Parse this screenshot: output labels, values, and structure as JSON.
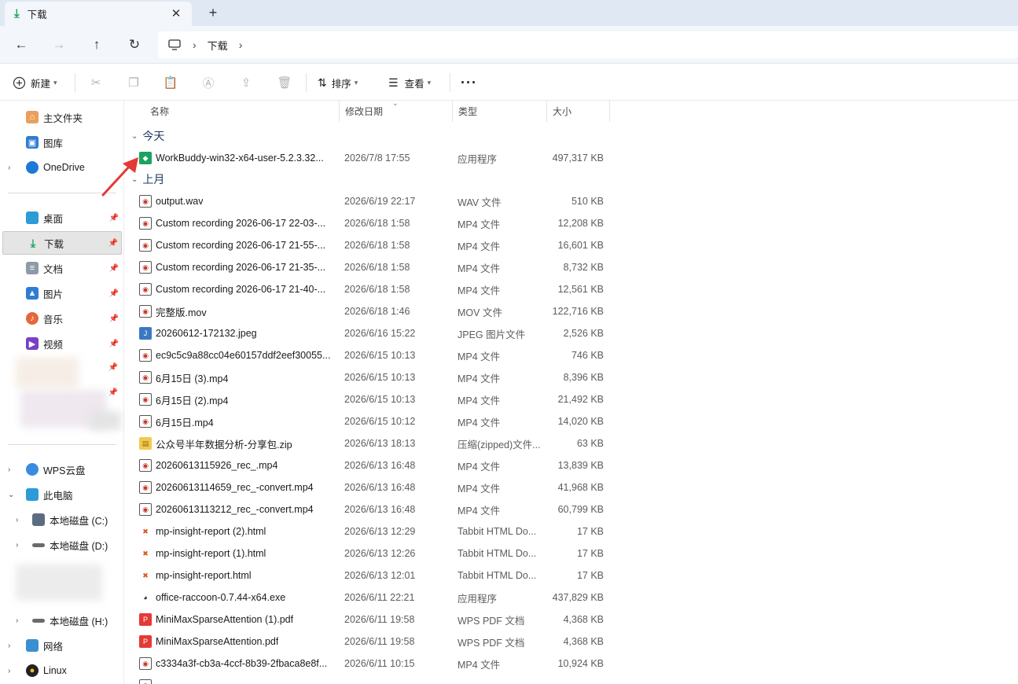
{
  "window": {
    "tab_title": "下载",
    "colors": {
      "titlebar": "#dfe8f3",
      "accent_green": "#1aa260",
      "selection": "#e5e5e5"
    }
  },
  "address": {
    "breadcrumbs": [
      "下载"
    ]
  },
  "toolbar": {
    "new_label": "新建",
    "sort_label": "排序",
    "view_label": "查看"
  },
  "sidebar": {
    "top": [
      {
        "label": "主文件夹",
        "icon": "home-icon"
      },
      {
        "label": "图库",
        "icon": "gallery-icon"
      },
      {
        "label": "OneDrive",
        "icon": "onedrive-icon"
      }
    ],
    "quick": [
      {
        "label": "桌面",
        "icon": "desktop-icon"
      },
      {
        "label": "下载",
        "icon": "download-icon"
      },
      {
        "label": "文档",
        "icon": "document-icon"
      },
      {
        "label": "图片",
        "icon": "picture-icon"
      },
      {
        "label": "音乐",
        "icon": "music-icon"
      },
      {
        "label": "视频",
        "icon": "video-icon"
      }
    ],
    "drives": [
      {
        "label": "WPS云盘",
        "icon": "wps-cloud-icon"
      },
      {
        "label": "此电脑",
        "icon": "this-pc-icon"
      },
      {
        "label": "本地磁盘 (C:)",
        "icon": "drive-c-icon"
      },
      {
        "label": "本地磁盘 (D:)",
        "icon": "drive-icon"
      },
      {
        "label": "本地磁盘 (H:)",
        "icon": "drive-icon"
      },
      {
        "label": "网络",
        "icon": "network-icon"
      },
      {
        "label": "Linux",
        "icon": "linux-icon"
      }
    ]
  },
  "columns": {
    "name": "名称",
    "date": "修改日期",
    "type": "类型",
    "size": "大小"
  },
  "groups": [
    {
      "label": "今天",
      "files": [
        {
          "name": "WorkBuddy-win32-x64-user-5.2.3.32...",
          "date": "2026/7/8 17:55",
          "type": "应用程序",
          "size": "497,317 KB",
          "icon": "app-installer-icon"
        }
      ]
    },
    {
      "label": "上月",
      "files": [
        {
          "name": "output.wav",
          "date": "2026/6/19 22:17",
          "type": "WAV 文件",
          "size": "510 KB",
          "icon": "media-file-icon"
        },
        {
          "name": "Custom recording 2026-06-17 22-03-...",
          "date": "2026/6/18 1:58",
          "type": "MP4 文件",
          "size": "12,208 KB",
          "icon": "media-file-icon"
        },
        {
          "name": "Custom recording 2026-06-17 21-55-...",
          "date": "2026/6/18 1:58",
          "type": "MP4 文件",
          "size": "16,601 KB",
          "icon": "media-file-icon"
        },
        {
          "name": "Custom recording 2026-06-17 21-35-...",
          "date": "2026/6/18 1:58",
          "type": "MP4 文件",
          "size": "8,732 KB",
          "icon": "media-file-icon"
        },
        {
          "name": "Custom recording 2026-06-17 21-40-...",
          "date": "2026/6/18 1:58",
          "type": "MP4 文件",
          "size": "12,561 KB",
          "icon": "media-file-icon"
        },
        {
          "name": "完整版.mov",
          "date": "2026/6/18 1:46",
          "type": "MOV 文件",
          "size": "122,716 KB",
          "icon": "media-file-icon"
        },
        {
          "name": "20260612-172132.jpeg",
          "date": "2026/6/16 15:22",
          "type": "JPEG 图片文件",
          "size": "2,526 KB",
          "icon": "jpeg-icon"
        },
        {
          "name": "ec9c5c9a88cc04e60157ddf2eef30055...",
          "date": "2026/6/15 10:13",
          "type": "MP4 文件",
          "size": "746 KB",
          "icon": "media-file-icon"
        },
        {
          "name": "6月15日 (3).mp4",
          "date": "2026/6/15 10:13",
          "type": "MP4 文件",
          "size": "8,396 KB",
          "icon": "media-file-icon"
        },
        {
          "name": "6月15日 (2).mp4",
          "date": "2026/6/15 10:13",
          "type": "MP4 文件",
          "size": "21,492 KB",
          "icon": "media-file-icon"
        },
        {
          "name": "6月15日.mp4",
          "date": "2026/6/15 10:12",
          "type": "MP4 文件",
          "size": "14,020 KB",
          "icon": "media-file-icon"
        },
        {
          "name": "公众号半年数据分析-分享包.zip",
          "date": "2026/6/13 18:13",
          "type": "压缩(zipped)文件...",
          "size": "63 KB",
          "icon": "zip-folder-icon"
        },
        {
          "name": "20260613115926_rec_.mp4",
          "date": "2026/6/13 16:48",
          "type": "MP4 文件",
          "size": "13,839 KB",
          "icon": "media-file-icon"
        },
        {
          "name": "20260613114659_rec_-convert.mp4",
          "date": "2026/6/13 16:48",
          "type": "MP4 文件",
          "size": "41,968 KB",
          "icon": "media-file-icon"
        },
        {
          "name": "20260613113212_rec_-convert.mp4",
          "date": "2026/6/13 16:48",
          "type": "MP4 文件",
          "size": "60,799 KB",
          "icon": "media-file-icon"
        },
        {
          "name": "mp-insight-report (2).html",
          "date": "2026/6/13 12:29",
          "type": "Tabbit HTML Do...",
          "size": "17 KB",
          "icon": "html-icon"
        },
        {
          "name": "mp-insight-report (1).html",
          "date": "2026/6/13 12:26",
          "type": "Tabbit HTML Do...",
          "size": "17 KB",
          "icon": "html-icon"
        },
        {
          "name": "mp-insight-report.html",
          "date": "2026/6/13 12:01",
          "type": "Tabbit HTML Do...",
          "size": "17 KB",
          "icon": "html-icon"
        },
        {
          "name": "office-raccoon-0.7.44-x64.exe",
          "date": "2026/6/11 22:21",
          "type": "应用程序",
          "size": "437,829 KB",
          "icon": "raccoon-exe-icon"
        },
        {
          "name": "MiniMaxSparseAttention (1).pdf",
          "date": "2026/6/11 19:58",
          "type": "WPS PDF 文档",
          "size": "4,368 KB",
          "icon": "pdf-icon"
        },
        {
          "name": "MiniMaxSparseAttention.pdf",
          "date": "2026/6/11 19:58",
          "type": "WPS PDF 文档",
          "size": "4,368 KB",
          "icon": "pdf-icon"
        },
        {
          "name": "c3334a3f-cb3a-4ccf-8b39-2fbaca8e8f...",
          "date": "2026/6/11 10:15",
          "type": "MP4 文件",
          "size": "10,924 KB",
          "icon": "media-file-icon"
        },
        {
          "name": "",
          "date": "",
          "type": "",
          "size": "",
          "icon": "media-file-icon"
        }
      ]
    }
  ]
}
